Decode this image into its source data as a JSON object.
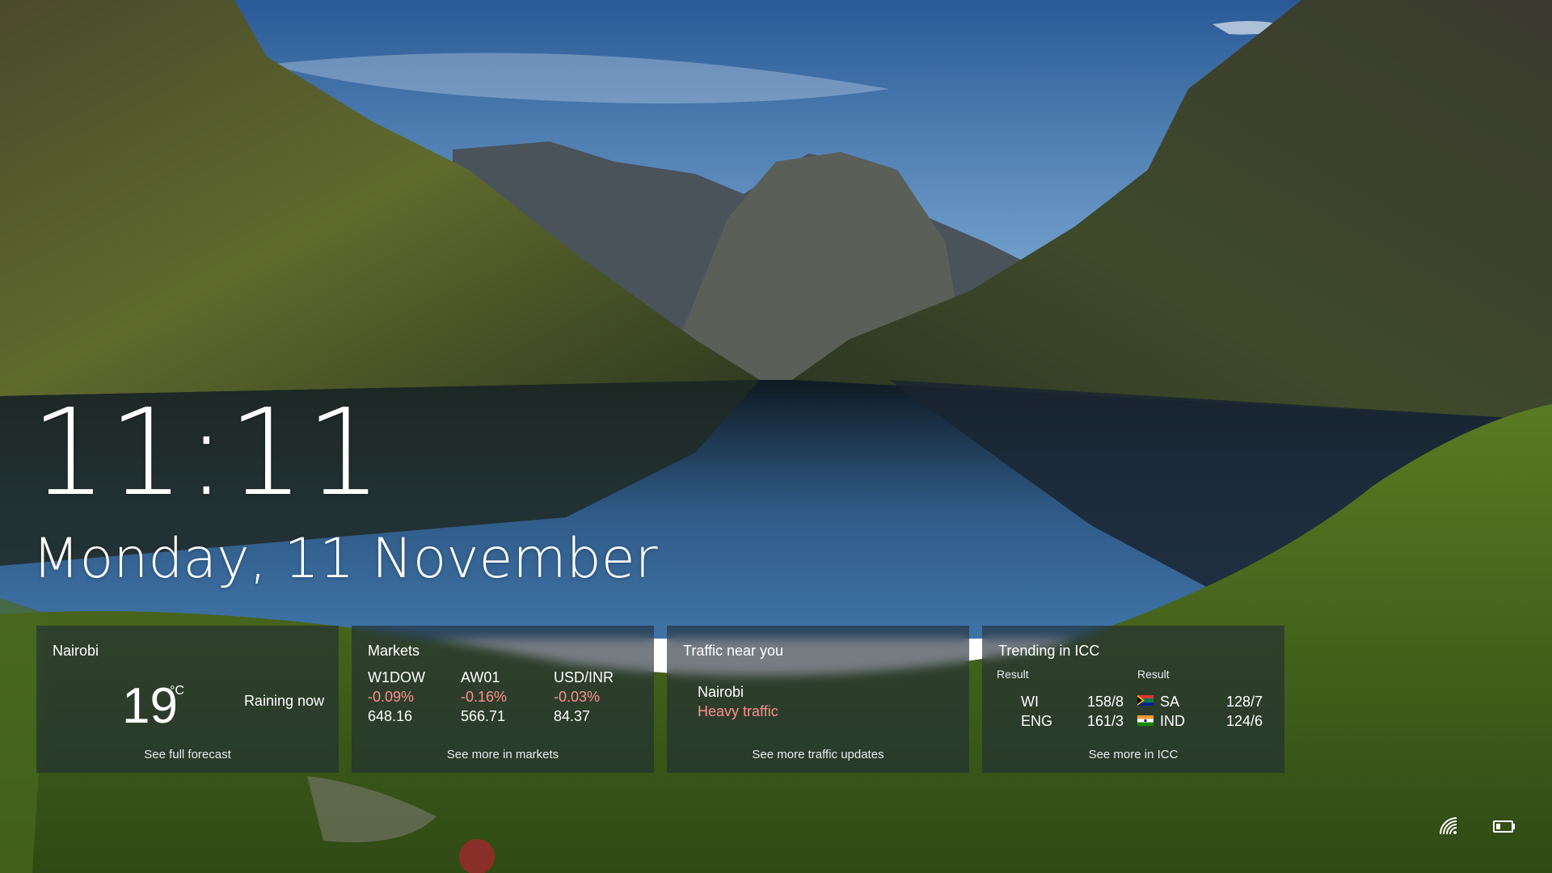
{
  "lockscreen": {
    "time": "11:11",
    "date": "Monday, 11 November"
  },
  "weather": {
    "city": "Nairobi",
    "temperature": "19",
    "unit": "°C",
    "condition": "Raining now",
    "link": "See full forecast"
  },
  "markets": {
    "title": "Markets",
    "items": [
      {
        "symbol": "W1DOW",
        "change": "-0.09%",
        "value": "648.16"
      },
      {
        "symbol": "AW01",
        "change": "-0.16%",
        "value": "566.71"
      },
      {
        "symbol": "USD/INR",
        "change": "-0.03%",
        "value": "84.37"
      }
    ],
    "link": "See more in markets",
    "negative_color": "#ff8e92"
  },
  "traffic": {
    "title": "Traffic near you",
    "location": "Nairobi",
    "status": "Heavy traffic",
    "link": "See more traffic updates"
  },
  "icc": {
    "title": "Trending in ICC",
    "matches": [
      {
        "label": "Result",
        "teams": [
          {
            "name": "WI",
            "score": "158/8"
          },
          {
            "name": "ENG",
            "score": "161/3"
          }
        ]
      },
      {
        "label": "Result",
        "teams": [
          {
            "name": "SA",
            "score": "128/7",
            "flag": "south-africa-flag"
          },
          {
            "name": "IND",
            "score": "124/6",
            "flag": "india-flag"
          }
        ]
      }
    ],
    "link": "See more in ICC"
  },
  "system": {
    "icons": [
      "network-icon",
      "battery-icon"
    ]
  }
}
